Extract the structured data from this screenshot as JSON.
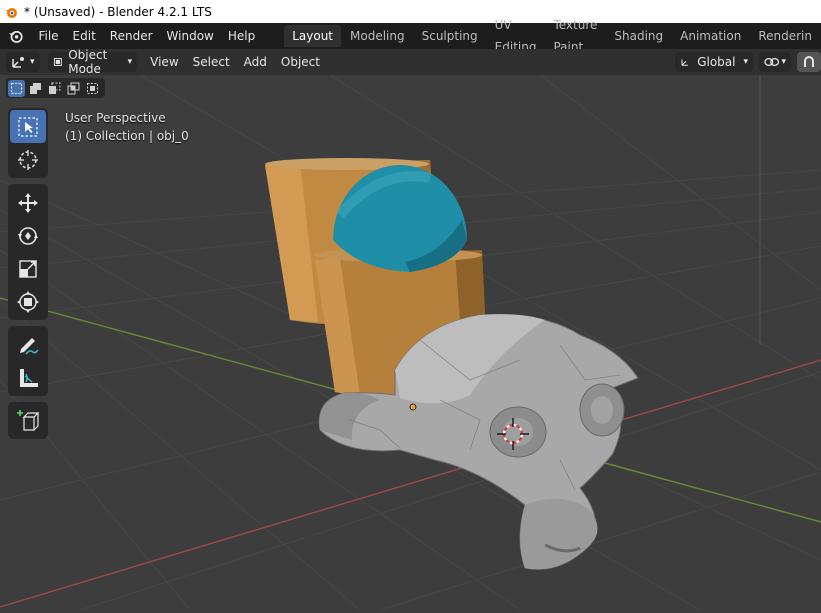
{
  "window": {
    "title": "* (Unsaved) - Blender 4.2.1 LTS"
  },
  "menubar": {
    "items": [
      "File",
      "Edit",
      "Render",
      "Window",
      "Help"
    ],
    "tabs": [
      {
        "label": "Layout",
        "active": true
      },
      {
        "label": "Modeling"
      },
      {
        "label": "Sculpting"
      },
      {
        "label": "UV Editing"
      },
      {
        "label": "Texture Paint"
      },
      {
        "label": "Shading"
      },
      {
        "label": "Animation"
      },
      {
        "label": "Renderin"
      }
    ]
  },
  "header": {
    "mode_label": "Object Mode",
    "menus": [
      "View",
      "Select",
      "Add",
      "Object"
    ],
    "orientation_label": "Global"
  },
  "viewport": {
    "perspective_label": "User Perspective",
    "collection_label": "(1) Collection | obj_0"
  },
  "toolbar": {
    "tools": [
      "select-box",
      "cursor",
      "move",
      "rotate",
      "scale",
      "transform",
      "annotate",
      "measure",
      "add-cube"
    ],
    "active": "select-box"
  },
  "colors": {
    "accent": "#4772b3",
    "background": "#3d3d3d",
    "header": "#303030",
    "menubar": "#1d1d1d",
    "cylinder": "#c08a43",
    "sphere": "#1f8fa8",
    "monkey": "#a8a8a8"
  }
}
